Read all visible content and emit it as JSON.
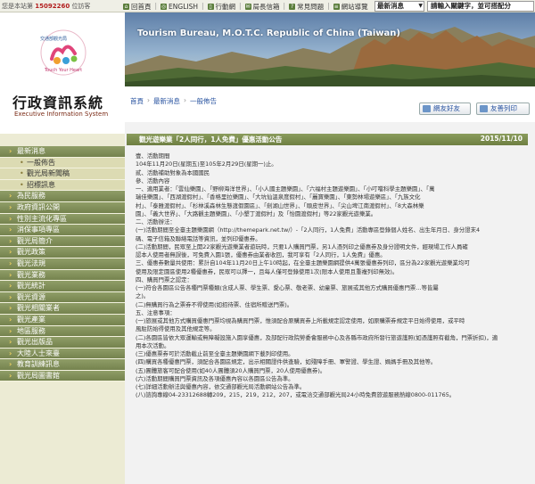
{
  "topbar": {
    "visitor_prefix": "您是本站第",
    "visitor_count": "15092260",
    "visitor_suffix": "位訪客",
    "nav": [
      {
        "label": "回首頁",
        "icon": "home-icon"
      },
      {
        "label": "ENGLISH",
        "icon": "globe-icon"
      },
      {
        "label": "行動網",
        "icon": "mobile-icon"
      },
      {
        "label": "局長信箱",
        "icon": "mail-icon"
      },
      {
        "label": "常見問題",
        "icon": "question-icon"
      },
      {
        "label": "網站導覽",
        "icon": "sitemap-icon"
      }
    ],
    "search_category": "最新消息",
    "search_placeholder": "請輸入關鍵字，並可搭配分"
  },
  "logo": {
    "small_text": "交通部觀光局",
    "brand": "Taiwan",
    "tagline": "Touch Your Heart",
    "site_title": "行政資訊系統",
    "site_subtitle": "Executive Information System"
  },
  "menu": [
    {
      "label": "最新消息",
      "type": "main"
    },
    {
      "label": "一般佈告",
      "type": "sub"
    },
    {
      "label": "觀光局新聞稿",
      "type": "sub"
    },
    {
      "label": "招標訊息",
      "type": "sub"
    },
    {
      "label": "為民服務",
      "type": "main"
    },
    {
      "label": "政府資訊公開",
      "type": "main"
    },
    {
      "label": "性別主流化專區",
      "type": "main"
    },
    {
      "label": "消保事項專區",
      "type": "main"
    },
    {
      "label": "觀光局簡介",
      "type": "main"
    },
    {
      "label": "觀光政策",
      "type": "main"
    },
    {
      "label": "觀光法規",
      "type": "main"
    },
    {
      "label": "觀光業務",
      "type": "main"
    },
    {
      "label": "觀光統計",
      "type": "main"
    },
    {
      "label": "觀光資源",
      "type": "main"
    },
    {
      "label": "觀光相關業者",
      "type": "main"
    },
    {
      "label": "觀光產業",
      "type": "main"
    },
    {
      "label": "地區服務",
      "type": "main"
    },
    {
      "label": "觀光出版品",
      "type": "main"
    },
    {
      "label": "大陸人士來臺",
      "type": "main"
    },
    {
      "label": "教育訓練訊息",
      "type": "main"
    },
    {
      "label": "觀光局圖書館",
      "type": "main"
    }
  ],
  "banner": {
    "title": "Tourism Bureau, M.O.T.C. Republic of China (Taiwan)"
  },
  "breadcrumb": [
    "首頁",
    "最新消息",
    "一般佈告"
  ],
  "tools": {
    "friend": "網友好友",
    "print": "友善列印"
  },
  "article": {
    "title": "觀光遊樂業「2人同行，1人免費」優惠活動公告",
    "date": "2015/11/10",
    "lines": [
      "壹、活動期間",
      "104年11月20日(星期五)至105年2月29日(星期一)止。",
      "貳、活動補助對象為本國國民",
      "參、活動內容",
      "一、適用業者：「雲仙樂園」、「野柳海洋世界」、「小人國主題樂園」、「六福村主題遊樂園」、「小叮噹科學主題樂園」、「萬",
      "瑞佳樂園」、「西湖渡假村」、「香格里拉樂園」、「大坑仙溫泉度假村」、「麗寶樂園」、「東勢林場遊樂區」、「九族文化",
      "村」、「泰雅渡假村」、「杉林溪森林生態渡假園區」、「劍湖山世界」、「頑皮世界」、「尖山埤江南渡假村」、「8大森林樂",
      "園」、「義大世界」、「大路觀主題樂園」、「小墾丁渡假村」及「怡園渡假村」等22家觀光遊樂業。",
      "二、活動辦法：",
      "(一)活動期間至全臺主題樂園網（http://themepark.net.tw/）-「2人同行，1人免費」活動專區登錄個人姓名、出生年月日、身分證末4",
      "碼、電子信箱及聯絡電話等資訊，並列印優惠券。",
      "(二)活動期間，民眾至上開22家觀光遊樂業者遊玩時，只要1人購買門票，另1人憑列印之優惠券及身分證明文件，經現場工作人員確",
      "認本人使用者無誤後，可免費入園1張，優惠券由業者收回，我可享有「2人同行，1人免費」優惠。",
      "三、優惠券數量共使用：累計自104年11月20日上午10時起，在全臺主題樂園網提供4萬張優惠券列印，區分為22家觀光遊樂業均可",
      "使用及限定園區使用2種優惠券，民眾可以擇一，且每人僅可登錄使用1次(限本人使用且重複列印無效)。",
      "四、購買門票之認定：",
      "(一)符合各園區公告各種門票種類(含成人票、學生票、愛心票、敬老票、幼童票、旅展或其他方式購買優惠門票…等皆屬",
      "之)。",
      "(二)無購買行為之票券不得使用(如招待票、住宿所贈送門票)。",
      "五、注意事項：",
      "(一)旅展或其他方式購買優惠門票均視為購買門票，惟須配合原購買券上所載規定認定使用，如原購票券規定平日始得使用，或平時",
      "風駐防始得使用及其他規定等。",
      "(二)各園區皆依大眾運輸或無障礙設施入園享優惠，及部配行政院勞委會服務中心及各縣市政府所發行旅遊護照(如憑護照有截角，門票折扣)，適",
      "用本次活動。",
      "(三)優惠票券可於活動截止前至全臺主題樂園網下載列印使用。",
      "(四)購買各種優惠門票，須配合各園區規定，出示相關證件供查驗，如殘障手冊、軍警證、學生證、媽媽手冊及其他等。",
      "(五)團體旅客可配合使用(如40人團體須20人購買門票，20人使用優惠券)。",
      "(六)活動期間購買門票資訊及各項優惠內容以各園區公告為準。",
      "(七)詳細活動辦法與優惠內容，依交通部觀光局活動網站公告為準。",
      "(八)諮詢專線04-23312688轉209，215，219，212，207，或電洽交通部觀光局24小時免費旅遊服務熱線0800-011765。"
    ]
  },
  "colors": {
    "menu_green": "#75834e",
    "header_green": "#6e7f42",
    "sidebar_bg": "#ecebd4",
    "link_blue": "#2b55a1"
  }
}
